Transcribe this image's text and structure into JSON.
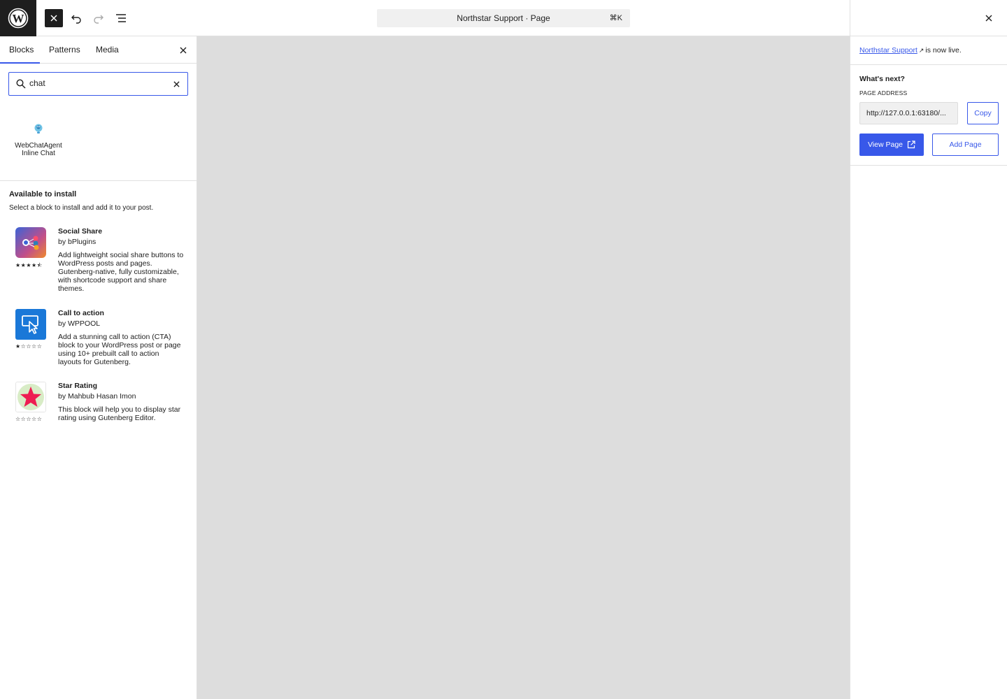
{
  "toolbar": {
    "document_title": "Northstar Support · Page",
    "command_shortcut": "⌘K"
  },
  "inserter": {
    "tabs": [
      {
        "label": "Blocks",
        "active": true
      },
      {
        "label": "Patterns",
        "active": false
      },
      {
        "label": "Media",
        "active": false
      }
    ],
    "search": {
      "value": "chat"
    },
    "results": [
      {
        "label": "WebChatAgent Inline Chat",
        "icon": "chat-agent-icon"
      }
    ],
    "available": {
      "title": "Available to install",
      "subtitle": "Select a block to install and add it to your post.",
      "plugins": [
        {
          "name": "Social Share",
          "author": "by bPlugins",
          "description": "Add lightweight social share buttons to WordPress posts and pages. Gutenberg-native, fully customizable, with shortcode support and share themes.",
          "stars": "★★★★⯪",
          "icon": "social-share-icon"
        },
        {
          "name": "Call to action",
          "author": "by WPPOOL",
          "description": "Add a stunning call to action (CTA) block to your WordPress post or page using 10+ prebuilt call to action layouts for Gutenberg.",
          "stars": "★☆☆☆☆",
          "icon": "cursor-click-icon"
        },
        {
          "name": "Star Rating",
          "author": "by Mahbub Hasan Imon",
          "description": "This block will help you to display star rating using Gutenberg Editor.",
          "stars": "☆☆☆☆☆",
          "icon": "star-icon"
        }
      ]
    }
  },
  "publish_panel": {
    "page_link": "Northstar Support",
    "live_suffix": "is now live.",
    "whats_next": "What's next?",
    "page_address_label": "PAGE ADDRESS",
    "page_address": "http://127.0.0.1:63180/...",
    "copy_label": "Copy",
    "view_page_label": "View Page",
    "add_page_label": "Add Page"
  },
  "colors": {
    "accent": "#3858e9",
    "canvas": "#dddddd",
    "dark": "#1e1e1e"
  }
}
